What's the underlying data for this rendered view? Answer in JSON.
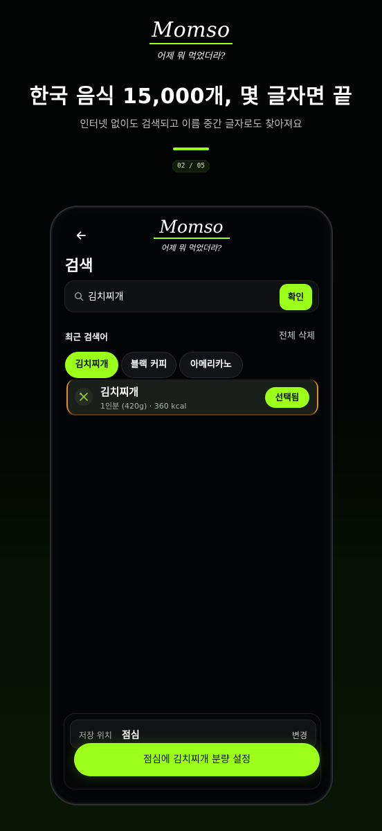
{
  "promo": {
    "logo_word": "Momso",
    "logo_tagline": "어제 뭐 먹었더라?",
    "headline": "한국 음식 15,000개, 몇 글자면 끝",
    "subline": "인터넷 없이도 검색되고 이름 중간 글자로도 찾아져요",
    "step": "02 / 05",
    "accent_color": "#9cff1a"
  },
  "app": {
    "back_icon": "arrow-left-icon",
    "logo_word": "Momso",
    "logo_tagline": "어제 뭐 먹었더라?",
    "page_title": "검색",
    "search": {
      "icon": "search-icon",
      "value": "김치찌개",
      "confirm_label": "확인"
    },
    "recent": {
      "label": "최근 검색어",
      "clear_all": "전체 삭제",
      "chips": [
        {
          "label": "김치찌개",
          "active": true
        },
        {
          "label": "블랙 커피",
          "active": false
        },
        {
          "label": "아메리카노",
          "active": false
        }
      ]
    },
    "result": {
      "icon": "fork-knife-icon",
      "name": "김치찌개",
      "meta": "1인분 (420g) · 360 kcal",
      "selected_label": "선택됨",
      "highlight_color": "#e68a22"
    },
    "meal": {
      "label": "저장 위치",
      "value": "점심",
      "change_label": "변경"
    },
    "cta_label": "점심에 김치찌개 분량 설정"
  }
}
